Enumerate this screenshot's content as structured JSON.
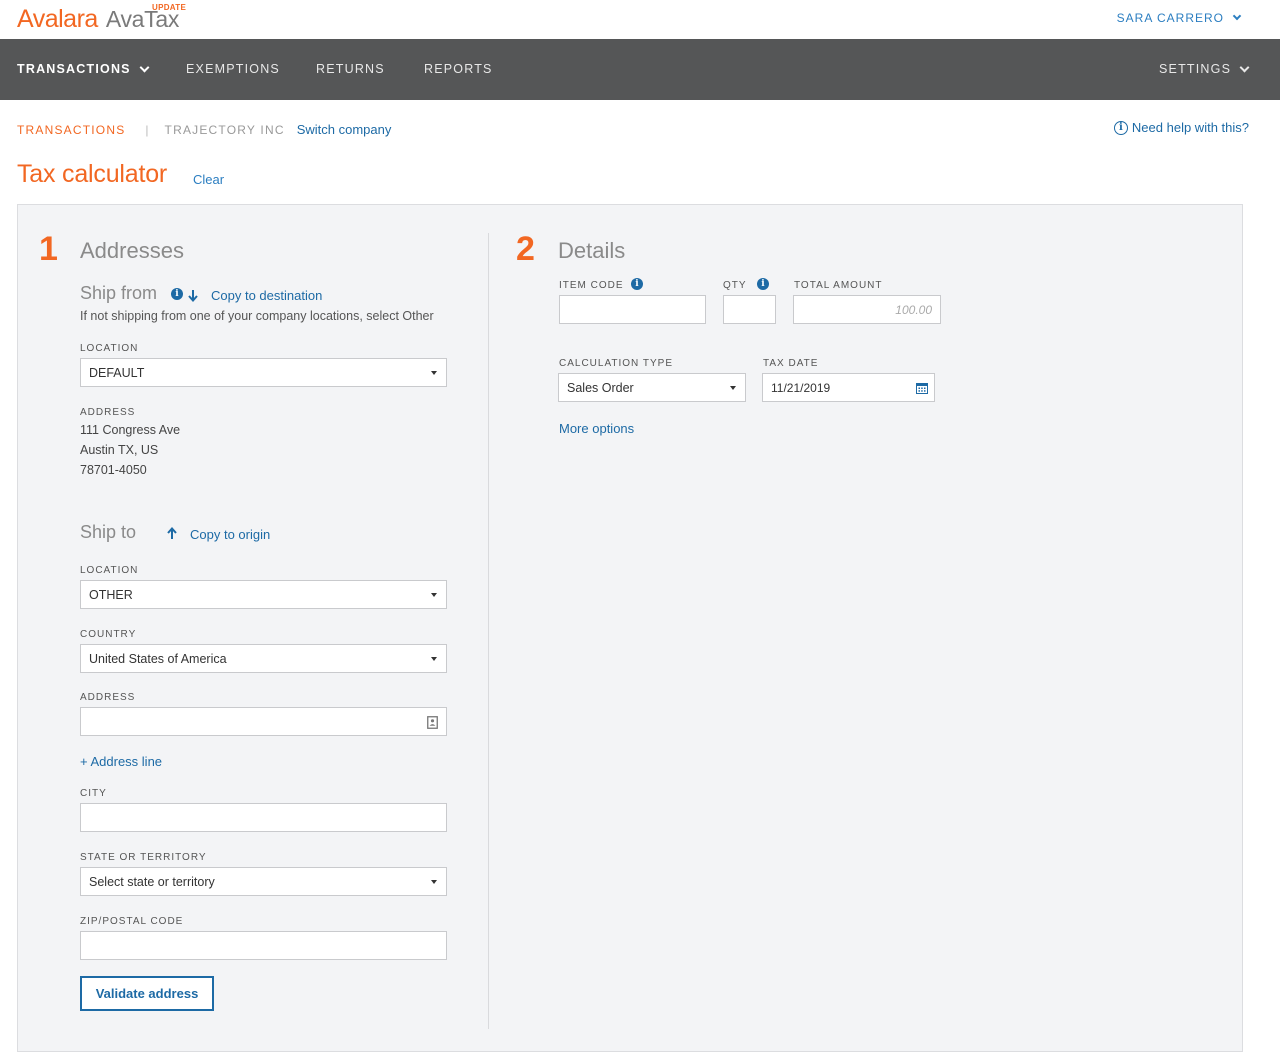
{
  "app": {
    "brand": "Avalara",
    "product": "AvaTax",
    "update_badge": "UPDATE",
    "user_name": "SARA CARRERO"
  },
  "nav": {
    "items": [
      {
        "label": "TRANSACTIONS",
        "active": true
      },
      {
        "label": "EXEMPTIONS"
      },
      {
        "label": "RETURNS"
      },
      {
        "label": "REPORTS"
      }
    ],
    "settings": "SETTINGS"
  },
  "breadcrumb": {
    "section": "TRANSACTIONS",
    "company": "TRAJECTORY INC",
    "switch_label": "Switch company"
  },
  "help_label": "Need help with this?",
  "page": {
    "title": "Tax calculator",
    "clear_label": "Clear"
  },
  "addresses": {
    "step": "1",
    "title": "Addresses",
    "ship_from": {
      "title": "Ship from",
      "copy_label": "Copy to destination",
      "note": "If not shipping from one of your company locations, select Other",
      "location_label": "LOCATION",
      "location_value": "DEFAULT",
      "address_label": "ADDRESS",
      "address_lines": [
        "111 Congress Ave",
        "Austin TX, US",
        "78701-4050"
      ]
    },
    "ship_to": {
      "title": "Ship to",
      "copy_label": "Copy to origin",
      "location_label": "LOCATION",
      "location_value": "OTHER",
      "country_label": "COUNTRY",
      "country_value": "United States of America",
      "address_label": "ADDRESS",
      "address_value": "",
      "add_line_label": "+ Address line",
      "city_label": "CITY",
      "city_value": "",
      "state_label": "STATE OR TERRITORY",
      "state_value": "Select state or territory",
      "zip_label": "ZIP/POSTAL CODE",
      "zip_value": "",
      "validate_label": "Validate address"
    }
  },
  "details": {
    "step": "2",
    "title": "Details",
    "item_code_label": "ITEM CODE",
    "item_code_value": "",
    "qty_label": "QTY",
    "qty_value": "",
    "total_label": "TOTAL AMOUNT",
    "total_placeholder": "100.00",
    "calc_type_label": "CALCULATION TYPE",
    "calc_type_value": "Sales Order",
    "tax_date_label": "TAX DATE",
    "tax_date_value": "11/21/2019",
    "more_options_label": "More options"
  },
  "colors": {
    "accent": "#f26722",
    "link": "#1d6aa5",
    "nav_bg": "#555657",
    "panel_bg": "#f3f4f6"
  },
  "icons": {
    "info": "info-icon",
    "arrow_down": "arrow-down-icon",
    "arrow_up": "arrow-up-icon",
    "calendar": "calendar-icon",
    "contact_card": "address-book-icon",
    "help": "help-circle-icon"
  }
}
